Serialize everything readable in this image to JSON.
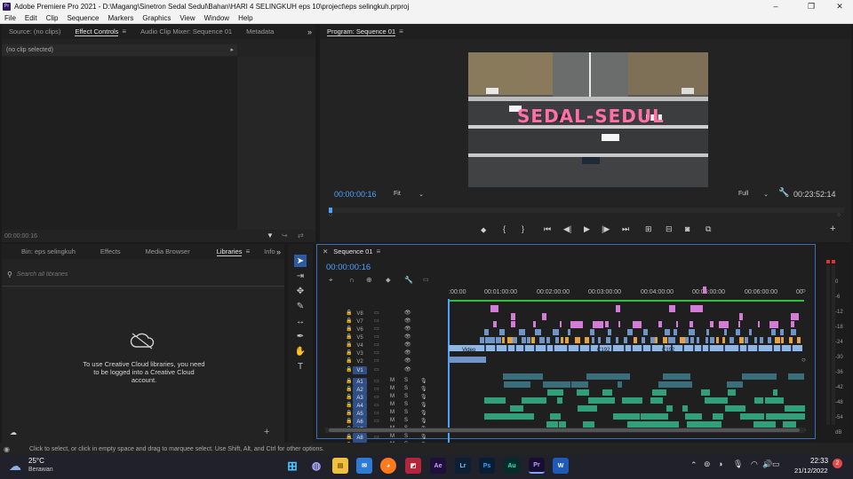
{
  "titlebar": {
    "app_icon": "Pr",
    "title": "Adobe Premiere Pro 2021 - D:\\Magang\\Sinetron Sedal Sedul\\Bahan\\HARI 4  SELINGKUH eps 10\\project\\eps selingkuh.prproj",
    "minimize": "–",
    "maximize": "❐",
    "close": "✕"
  },
  "menu": [
    "File",
    "Edit",
    "Clip",
    "Sequence",
    "Markers",
    "Graphics",
    "View",
    "Window",
    "Help"
  ],
  "source_panel": {
    "tabs": [
      "Source: (no clips)",
      "Effect Controls",
      "Audio Clip Mixer: Sequence 01",
      "Metadata"
    ],
    "active_tab": 1,
    "no_clip": "(no clip selected)",
    "timecode": "00:00:00:16"
  },
  "program_panel": {
    "title": "Program: Sequence 01",
    "overlay_text": "SEDAL-SEDUL",
    "timecode_left": "00:00:00:16",
    "fit": "Fit",
    "quality": "Full",
    "timecode_right": "00:23:52:14"
  },
  "project_panel": {
    "tabs": [
      "Bin: eps selingkuh",
      "Effects",
      "Media Browser",
      "Libraries",
      "Info"
    ],
    "active_tab": 3,
    "search_placeholder": "Search all libraries",
    "cc_message": "To use Creative Cloud libraries, you need to be logged into a Creative Cloud account."
  },
  "timeline": {
    "tab": "Sequence 01",
    "timecode": "00:00:00:16",
    "ruler": [
      ":00:00",
      "00:01:00:00",
      "00:02:00:00",
      "00:03:00:00",
      "00:04:00:00",
      "00:05:00:00",
      "00:06:00:00",
      "00"
    ],
    "video_tracks": [
      "V8",
      "V7",
      "V6",
      "V5",
      "V4",
      "V3",
      "V2",
      "V1"
    ],
    "audio_tracks": [
      "A1",
      "A2",
      "A3",
      "A4",
      "A5",
      "A6",
      "A7",
      "A8",
      "A9"
    ],
    "mute": "M",
    "solo": "S",
    "clip_labels": [
      "Video",
      "C192",
      "C192"
    ],
    "fx_label": "fx"
  },
  "meters": {
    "labels": [
      "0",
      "-6",
      "-12",
      "-18",
      "-24",
      "-30",
      "-36",
      "-42",
      "-48",
      "-54",
      "dB"
    ]
  },
  "statusbar": {
    "text": "Click to select, or click in empty space and drag to marquee select. Use Shift, Alt, and Ctrl for other options."
  },
  "taskbar": {
    "weather_temp": "25°C",
    "weather_desc": "Berawan",
    "time": "22:33",
    "date": "21/12/2022",
    "notification_count": "2",
    "apps": [
      "Ae",
      "Lr",
      "Ps",
      "Au",
      "Pr",
      "W"
    ]
  }
}
